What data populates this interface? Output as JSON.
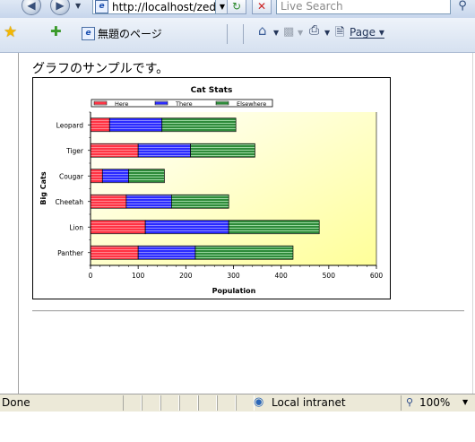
{
  "browser": {
    "url": "http://localhost/zed",
    "search_placeholder": "Live Search",
    "tab_title": "無題のページ",
    "page_menu_label": "Page"
  },
  "page": {
    "heading": "グラフのサンプルです。"
  },
  "status": {
    "text": "Done",
    "zone": "Local intranet",
    "zoom": "100%"
  },
  "icons": {
    "back": "back-arrow-icon",
    "forward": "forward-arrow-icon",
    "refresh": "refresh-icon",
    "stop": "stop-icon",
    "search": "search-icon",
    "favorites": "favorites-star-icon",
    "add_favorite": "add-favorite-icon",
    "home": "home-icon",
    "feeds": "feeds-icon",
    "print": "print-icon",
    "page": "page-icon",
    "zone": "local-intranet-icon",
    "zoom": "zoom-icon"
  },
  "chart_data": {
    "type": "bar",
    "orientation": "horizontal",
    "stacked": true,
    "title": "Cat Stats",
    "xlabel": "Population",
    "ylabel": "Big Cats",
    "xlim": [
      0,
      600
    ],
    "xticks": [
      0,
      100,
      200,
      300,
      400,
      500,
      600
    ],
    "categories": [
      "Panther",
      "Lion",
      "Cheetah",
      "Cougar",
      "Tiger",
      "Leopard"
    ],
    "legend_position": "top",
    "background": "gradient white to light yellow",
    "series": [
      {
        "name": "Here",
        "color": "#ff3344",
        "values": [
          100,
          115,
          75,
          25,
          100,
          40
        ]
      },
      {
        "name": "There",
        "color": "#2a2aff",
        "values": [
          120,
          175,
          95,
          55,
          110,
          110
        ]
      },
      {
        "name": "Elsewhere",
        "color": "#2e8b3a",
        "values": [
          205,
          190,
          120,
          75,
          135,
          155
        ]
      }
    ]
  }
}
